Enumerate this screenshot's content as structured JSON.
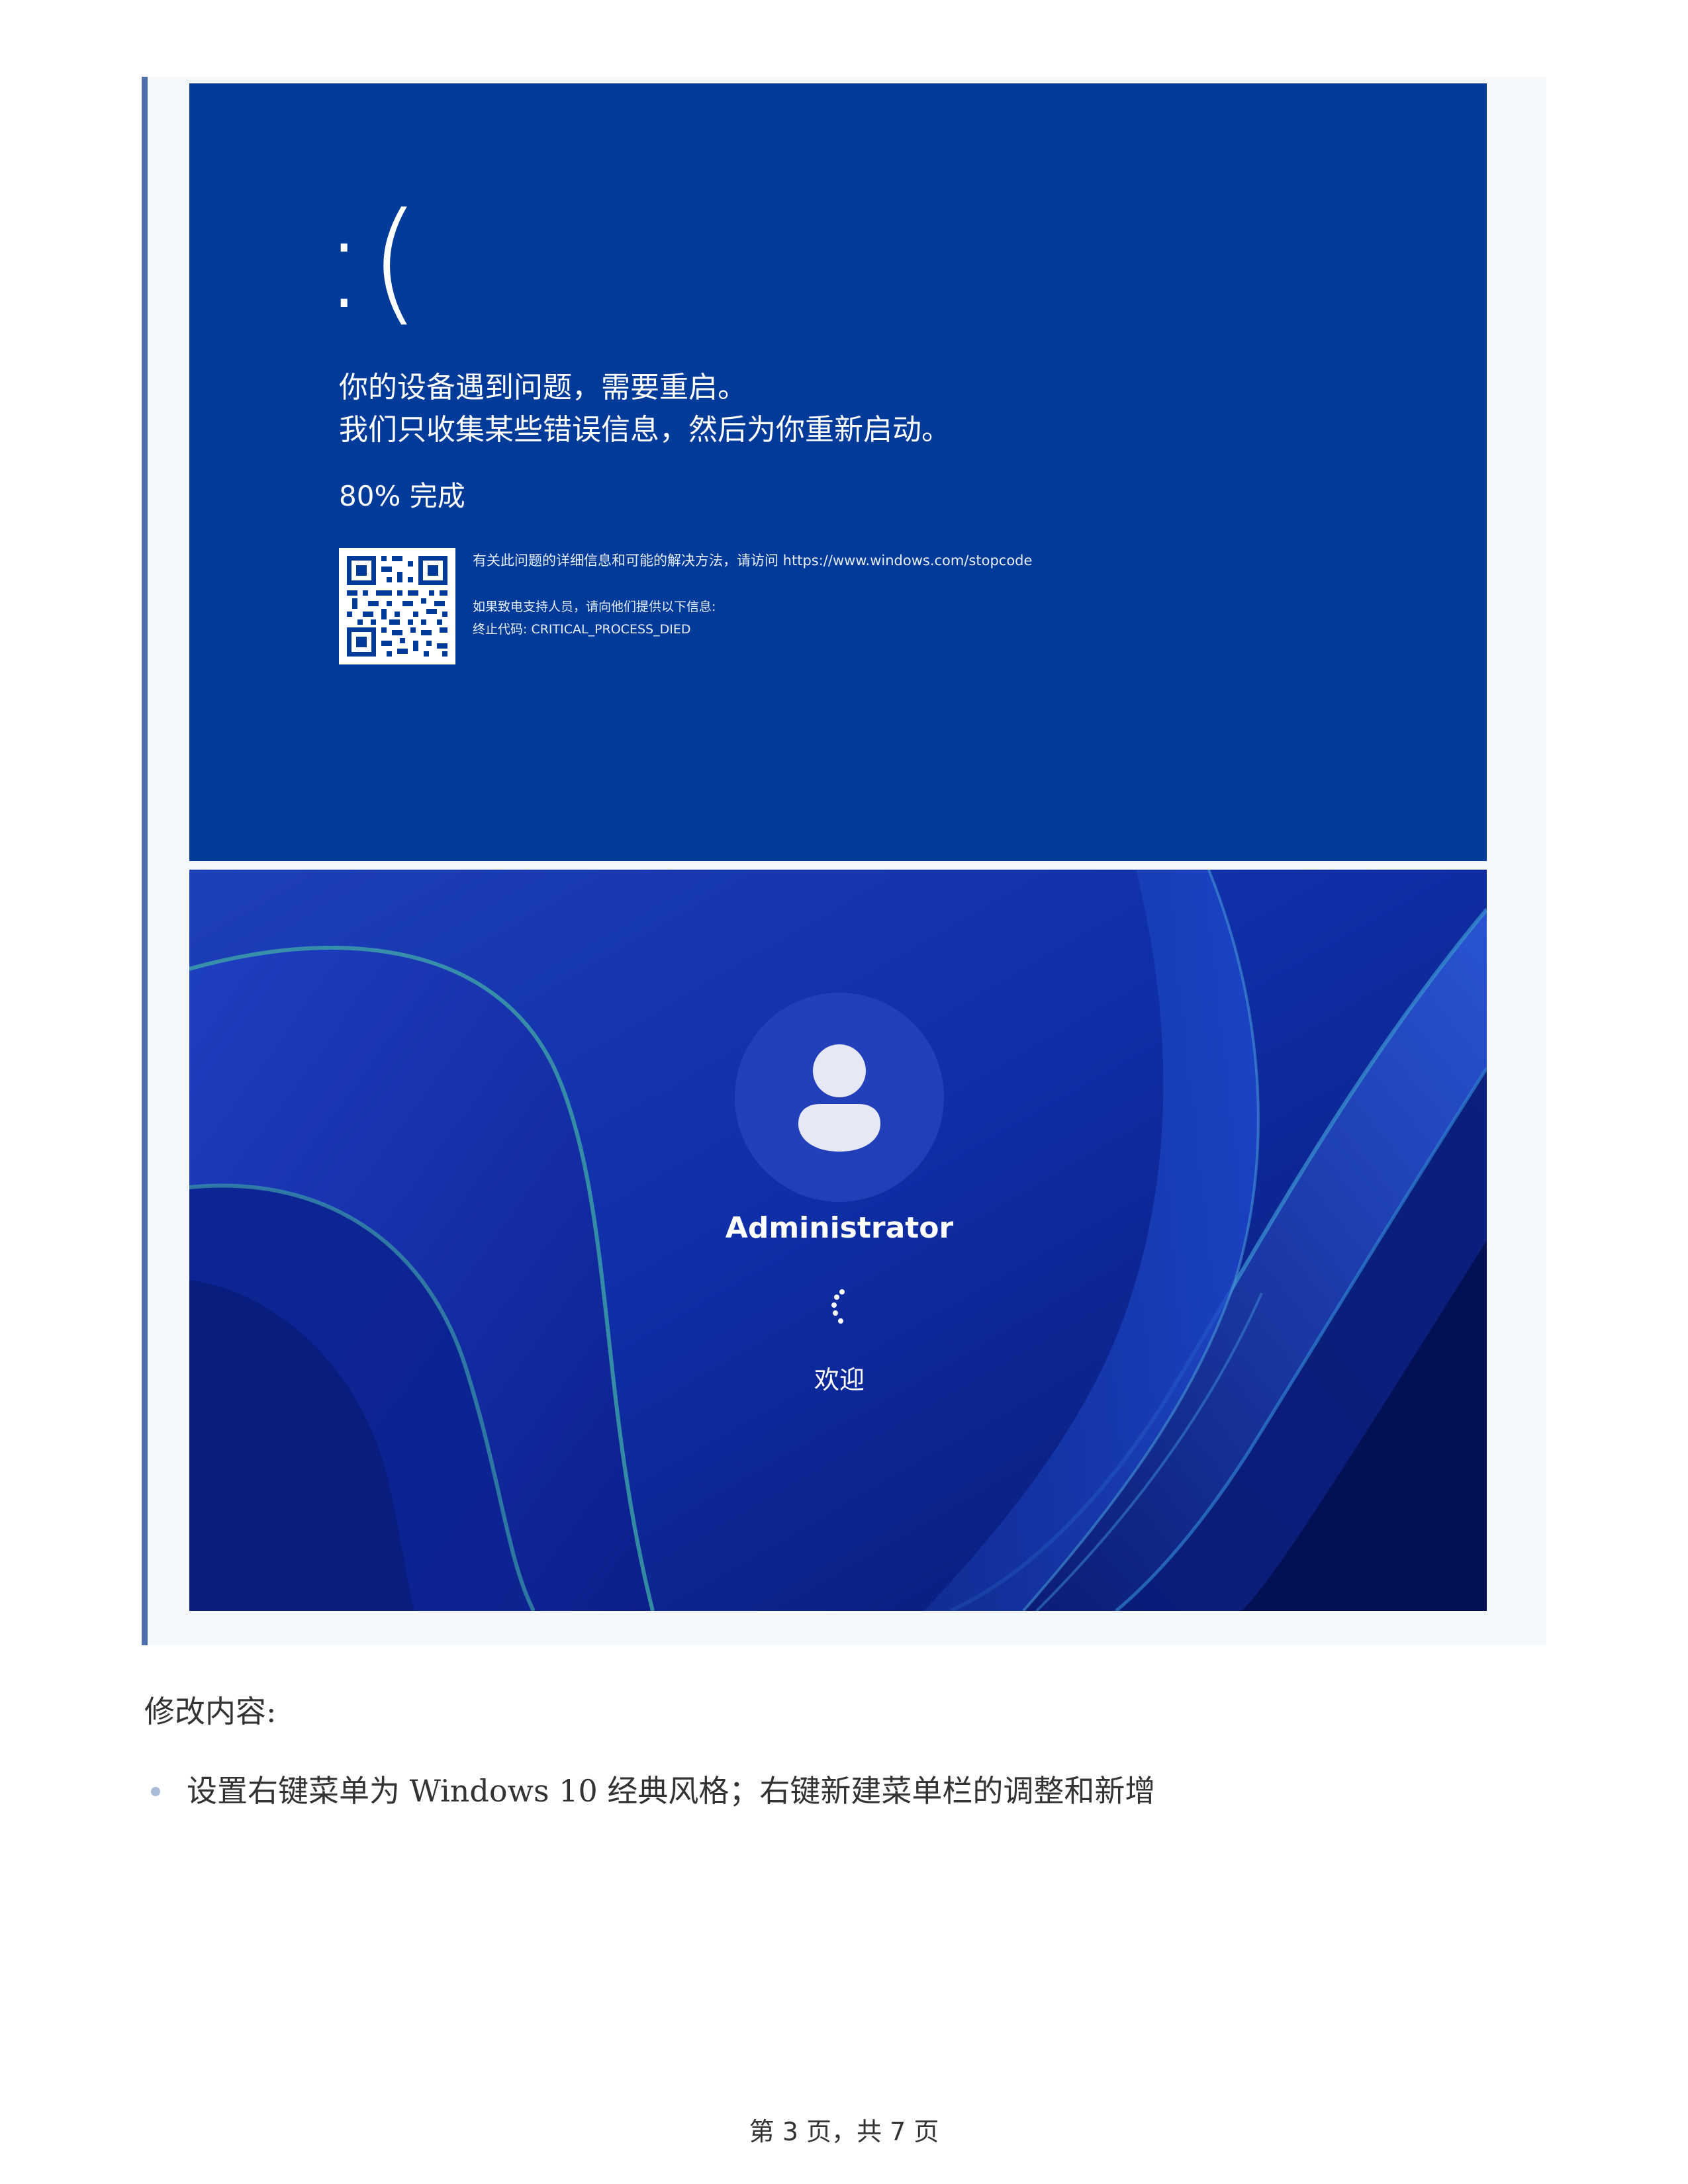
{
  "bsod": {
    "sad_face": ":(",
    "line1": "你的设备遇到问题，需要重启。",
    "line2": "我们只收集某些错误信息，然后为你重新启动。",
    "progress": "80% 完成",
    "info_line1": "有关此问题的详细信息和可能的解决方法，请访问 https://www.windows.com/stopcode",
    "info_line2": "如果致电支持人员，请向他们提供以下信息:",
    "info_line3": "终止代码: CRITICAL_PROCESS_DIED",
    "background_color": "#003b99"
  },
  "login": {
    "username": "Administrator",
    "status": "欢迎",
    "avatar_icon": "user-icon",
    "spinner_icon": "loading-spinner-icon"
  },
  "content": {
    "section_label": "修改内容:",
    "bullets": [
      "设置右键菜单为 Windows 10 经典风格；右键新建菜单栏的调整和新增"
    ]
  },
  "footer": {
    "page_number": "第 3 页，共 7 页"
  }
}
